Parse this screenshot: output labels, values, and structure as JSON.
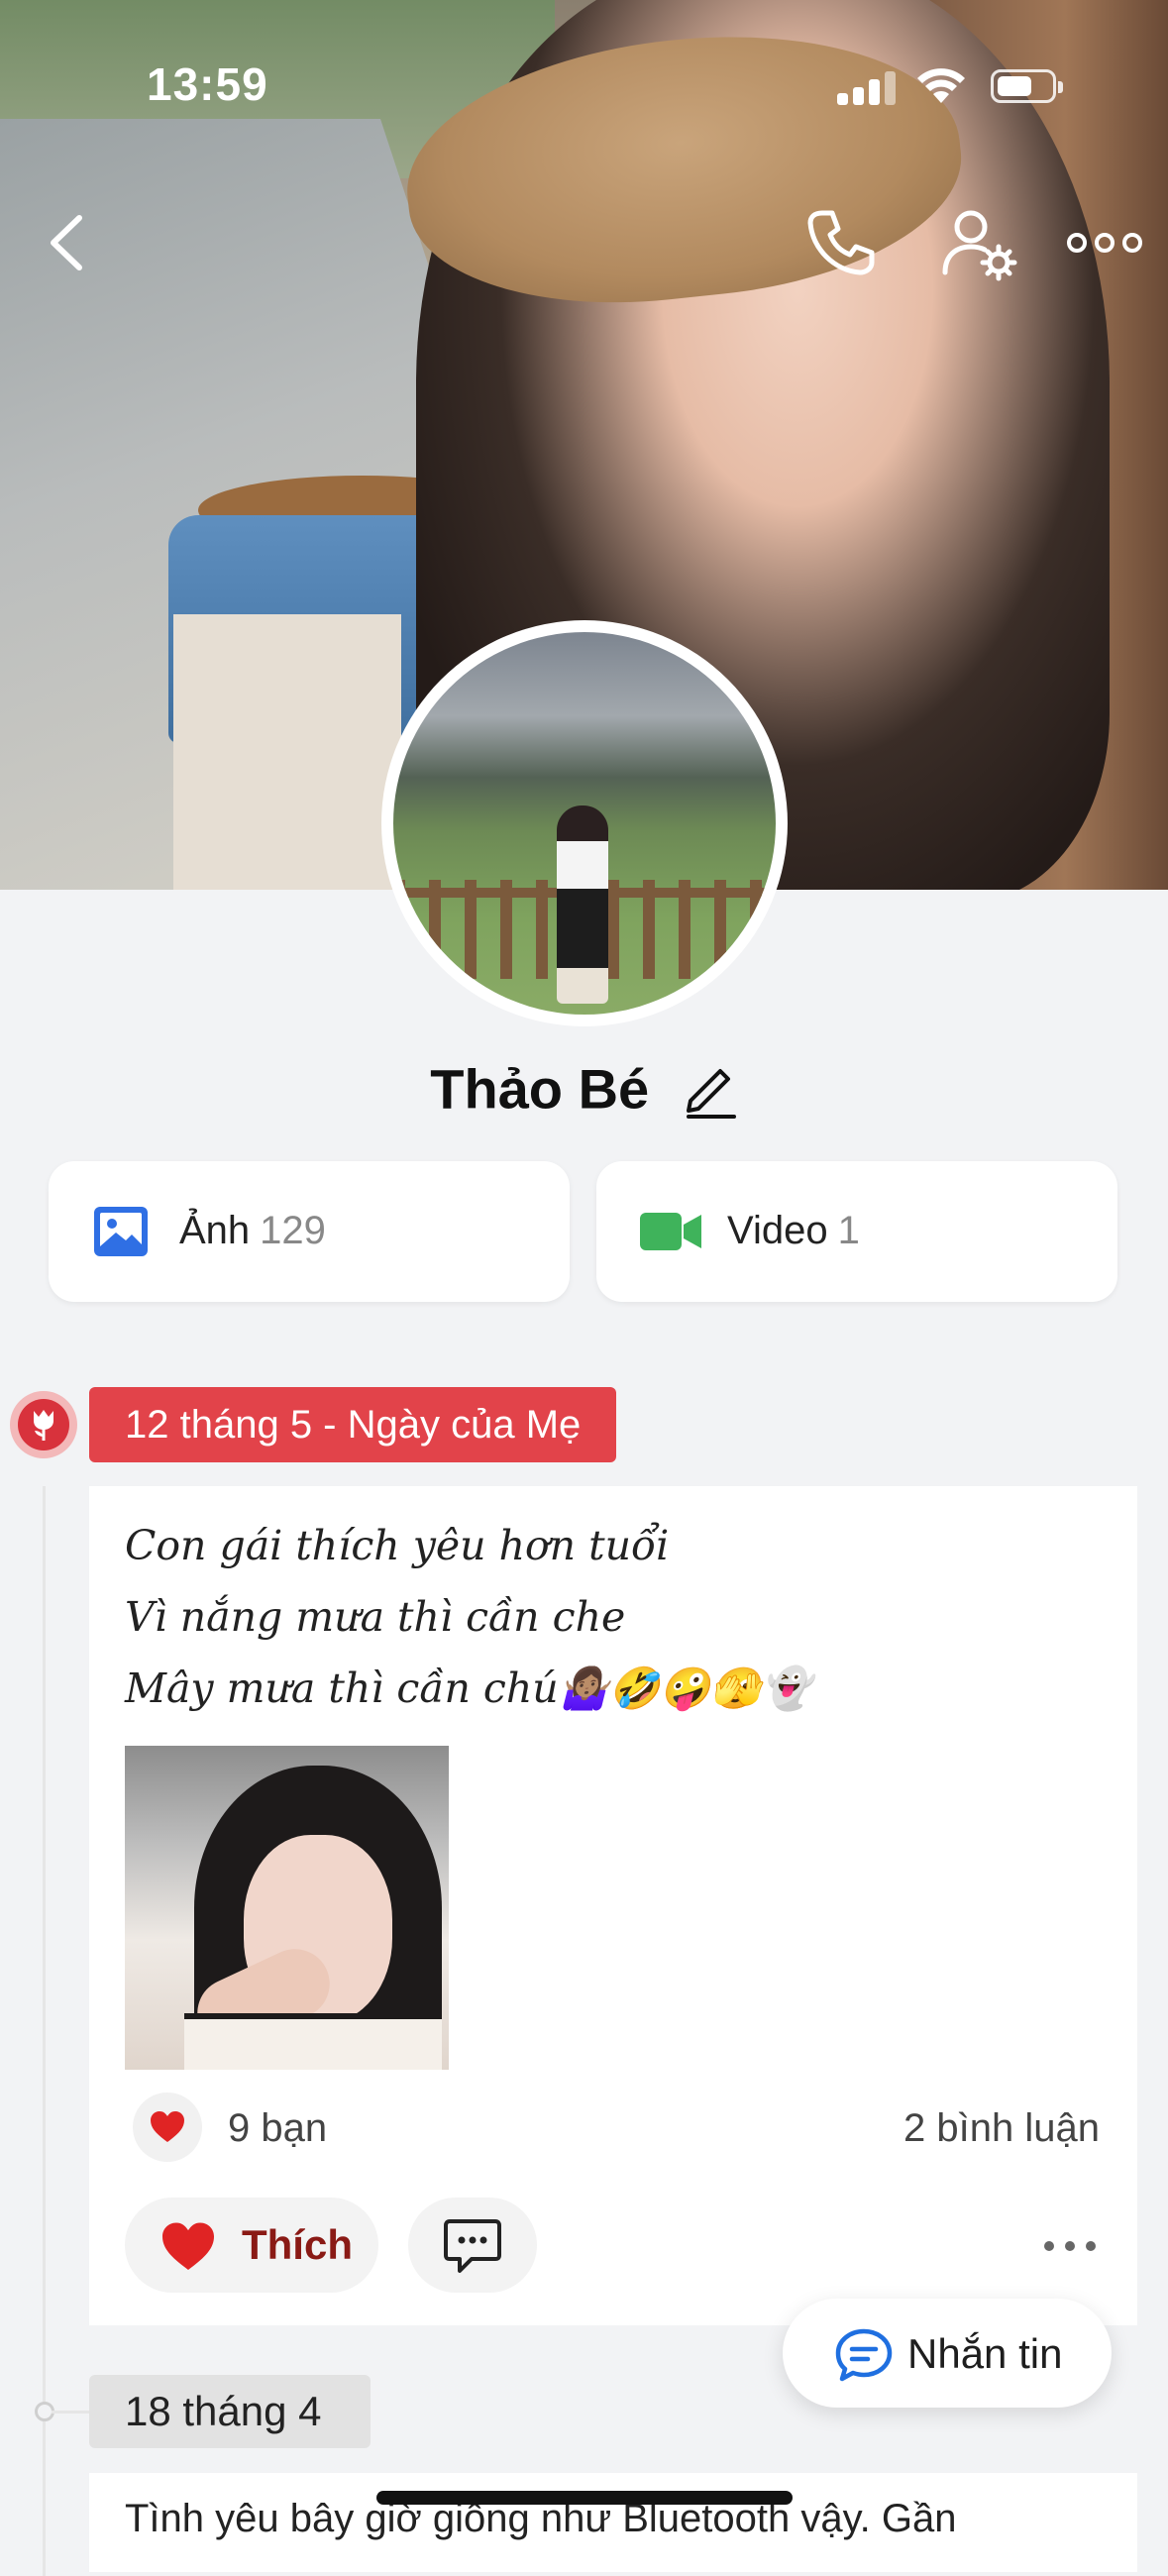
{
  "status_bar": {
    "time": "13:59"
  },
  "profile": {
    "name": "Thảo Bé"
  },
  "media": {
    "photos_label": "Ảnh",
    "photos_count": "129",
    "videos_label": "Video",
    "videos_count": "1"
  },
  "timeline": {
    "post1": {
      "date_label": "12 tháng 5 - Ngày của Mẹ",
      "text": "Con gái thích yêu hơn tuổi\nVì nắng mưa thì cần che\nMây mưa thì cần chú🤷🏽‍♀️🤣🤪🫣👻",
      "likes": "9 bạn",
      "comments": "2 bình luận",
      "like_button_label": "Thích"
    },
    "post2": {
      "date_label": "18 tháng 4",
      "text": "Tình yêu bây giờ giống như Bluetooth vậy. Gần"
    }
  },
  "message_button": {
    "label": "Nhắn tin"
  },
  "colors": {
    "holiday_red": "#e2434a",
    "photo_icon_blue": "#2f6fe4",
    "video_icon_green": "#3fb35b",
    "like_red": "#e02424",
    "message_blue": "#1f6fe0"
  }
}
